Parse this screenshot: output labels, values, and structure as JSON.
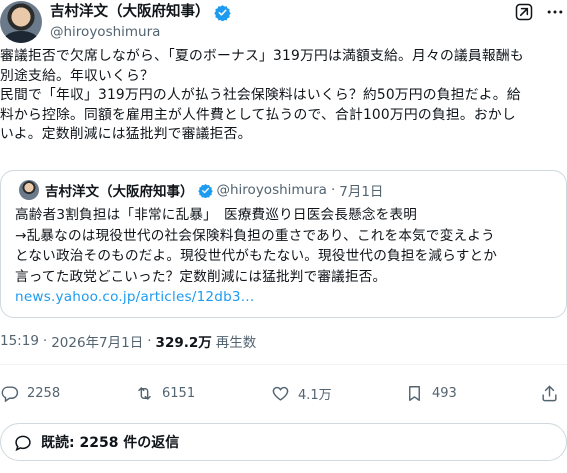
{
  "post": {
    "author_name": "吉村洋文（大阪府知事）",
    "handle": "@hiroyoshimura",
    "body_lines": [
      "審議拒否で欠席しながら、「夏のボーナス」319万円は満額支給。月々の議員報酬も",
      "別途支給。年収いくら？",
      "民間で「年収」319万円の人が払う社会保険料はいくら？約50万円の負担だよ。給",
      "料から控除。同額を雇用主が人件費として払うので、合計100万円の負担。おかし",
      "いよ。定数削減には猛批判で審議拒否。"
    ]
  },
  "quote": {
    "author_name": "吉村洋文（大阪府知事）",
    "handle": "@hiroyoshimura",
    "separator": "·",
    "date": "7月1日",
    "text_lines": [
      "高齢者3割負担は「非常に乱暴」　医療費巡り日医会長懸念を表明",
      "→乱暴なのは現役世代の社会保険料負担の重さであり、これを本気で変えよう",
      "とない政治そのものだよ。現役世代がもたない。現役世代の負担を減らすとか",
      "言ってた政党どこいった？定数削減には猛批判で審議拒否。"
    ],
    "link_text": "news.yahoo.co.jp/articles/12db3..."
  },
  "meta": {
    "time": "15:19",
    "separator": "·",
    "date": "2026年7月1日",
    "separator2": "·",
    "views": "329.2万",
    "views_label": "再生数"
  },
  "actions": {
    "replies": "2258",
    "reposts": "6151",
    "likes": "4.1万",
    "bookmarks": "493"
  },
  "reply_summary": "既読: 2258 件の返信",
  "colors": {
    "accent": "#1d9bf0",
    "text": "#0f1419",
    "muted": "#536471",
    "border": "#cfd9de"
  },
  "icons": [
    "verified-badge-icon",
    "grok-icon",
    "more-icon",
    "reply-icon",
    "repost-icon",
    "like-icon",
    "bookmark-icon",
    "share-icon",
    "chat-bubble-icon"
  ]
}
